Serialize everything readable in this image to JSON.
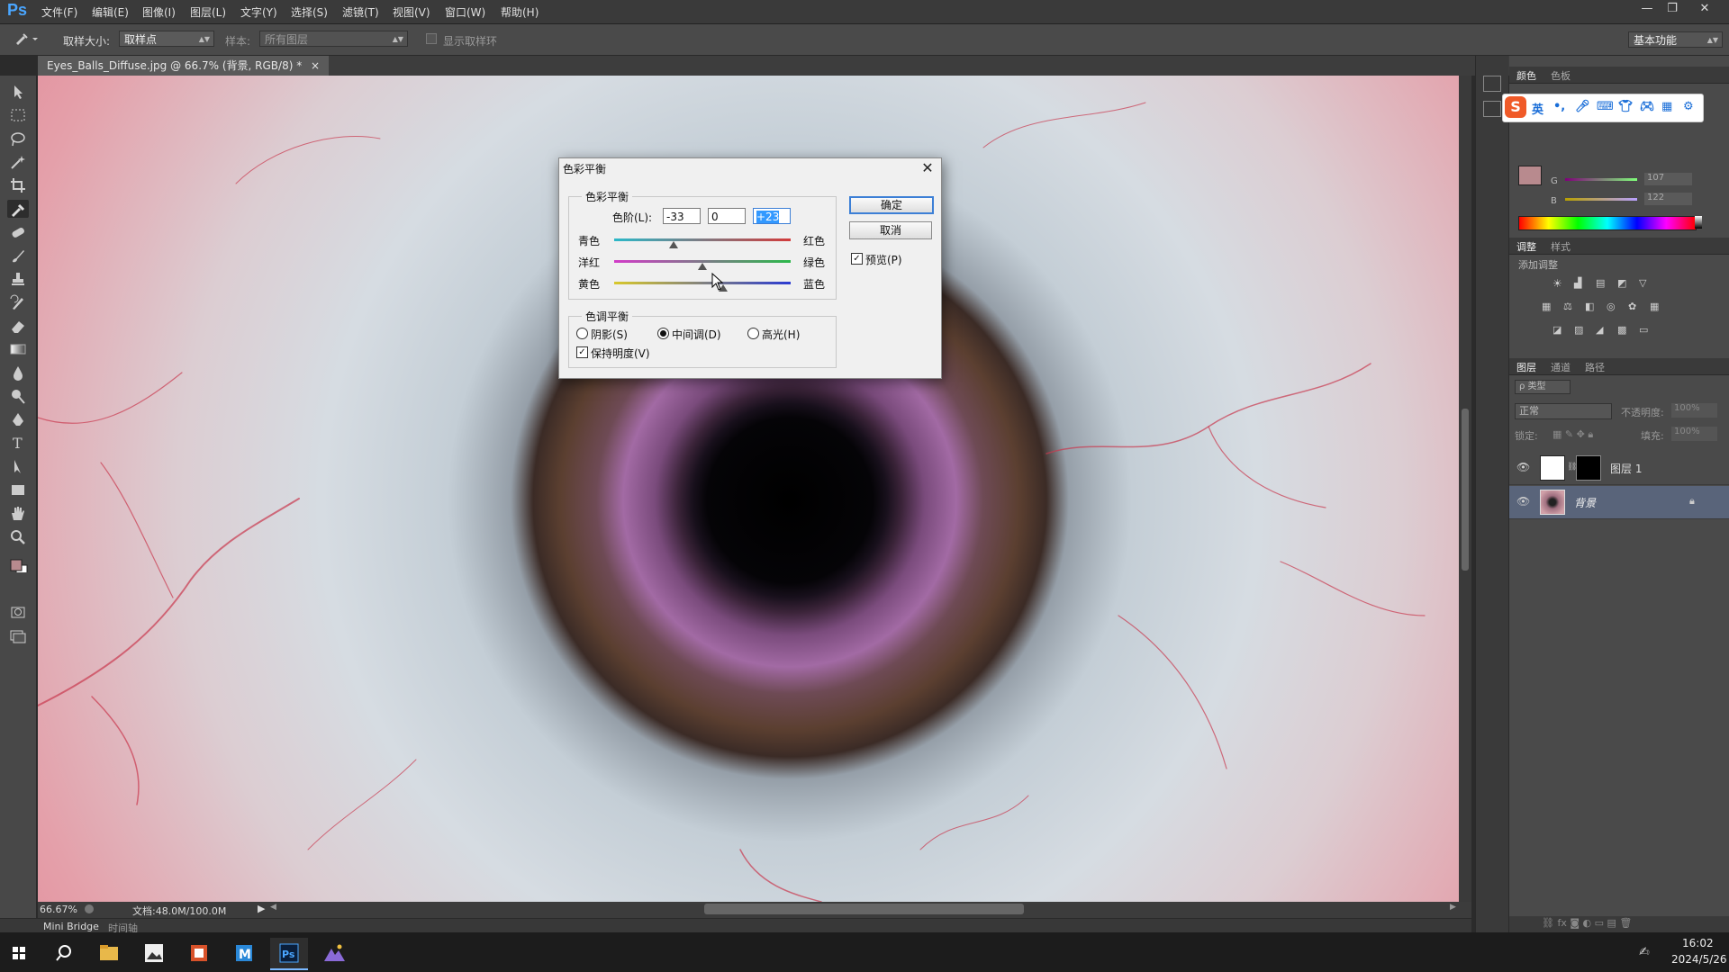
{
  "app": {
    "logo": "Ps"
  },
  "menu": [
    "文件(F)",
    "编辑(E)",
    "图像(I)",
    "图层(L)",
    "文字(Y)",
    "选择(S)",
    "滤镜(T)",
    "视图(V)",
    "窗口(W)",
    "帮助(H)"
  ],
  "window_controls": {
    "minimize": "—",
    "restore": "❐",
    "close": "✕"
  },
  "options": {
    "sample_size_label": "取样大小:",
    "sample_size_value": "取样点",
    "sample_label": "样本:",
    "sample_value": "所有图层",
    "show_ring_label": "显示取样环",
    "workspace": "基本功能"
  },
  "document": {
    "tab_title": "Eyes_Balls_Diffuse.jpg @ 66.7% (背景, RGB/8) *",
    "tab_close": "×"
  },
  "status": {
    "zoom": "66.67%",
    "doc_info": "文档:48.0M/100.0M"
  },
  "bottom_tabs": [
    "Mini Bridge",
    "时间轴"
  ],
  "panels": {
    "color_tabs": [
      "颜色",
      "色板"
    ],
    "color_channels": [
      {
        "label": "G",
        "value": "107"
      },
      {
        "label": "B",
        "value": "122"
      }
    ],
    "adjust_tabs": [
      "调整",
      "样式"
    ],
    "adjust_title": "添加调整",
    "layers_tabs": [
      "图层",
      "通道",
      "路径"
    ],
    "layer_filter": "ρ 类型",
    "blend_mode": "正常",
    "opacity_label": "不透明度:",
    "opacity_value": "100%",
    "lock_label": "锁定:",
    "fill_label": "填充:",
    "fill_value": "100%",
    "layers": [
      {
        "name": "图层 1",
        "selected": false
      },
      {
        "name": "背景",
        "selected": true
      }
    ]
  },
  "dialog": {
    "title": "色彩平衡",
    "close": "✕",
    "group_color_balance": "色彩平衡",
    "levels_label": "色阶(L):",
    "levels": [
      "-33",
      "0",
      "+23"
    ],
    "sliders": [
      {
        "left": "青色",
        "right": "红色",
        "value": -33,
        "gradient": [
          "#2bb8c8",
          "#d23b3b"
        ]
      },
      {
        "left": "洋红",
        "right": "绿色",
        "value": 0,
        "gradient": [
          "#d23bc8",
          "#2bb84a"
        ]
      },
      {
        "left": "黄色",
        "right": "蓝色",
        "value": 23,
        "gradient": [
          "#d8c82b",
          "#2b3bd2"
        ]
      }
    ],
    "ok": "确定",
    "cancel": "取消",
    "preview_label": "预览(P)",
    "preview_checked": true,
    "group_tone_balance": "色调平衡",
    "tones": [
      {
        "label": "阴影(S)",
        "checked": false
      },
      {
        "label": "中间调(D)",
        "checked": true
      },
      {
        "label": "高光(H)",
        "checked": false
      }
    ],
    "preserve_label": "保持明度(V)",
    "preserve_checked": true
  },
  "ime": {
    "logo": "S",
    "items": [
      "英",
      "•,",
      "mic-icon",
      "keyboard-icon",
      "shirt-icon",
      "gamepad-icon",
      "grid-icon",
      "settings-icon"
    ]
  },
  "taskbar": {
    "time": "16:02",
    "date": "2024/5/26"
  },
  "colors": {
    "accent": "#3c7fd6",
    "ps_blue": "#4aa6ff"
  }
}
